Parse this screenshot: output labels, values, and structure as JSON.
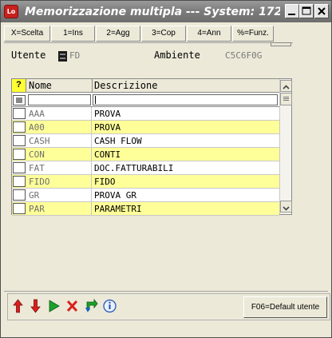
{
  "window": {
    "title": "Memorizzazione multipla --- System: 172...."
  },
  "titlebar_buttons": [
    "minimize-icon",
    "maximize-icon",
    "close-icon"
  ],
  "function_keys": [
    {
      "label": "X=Scelta"
    },
    {
      "label": "1=Ins"
    },
    {
      "label": "2=Agg"
    },
    {
      "label": "3=Cop"
    },
    {
      "label": "4=Ann"
    },
    {
      "label": "%=Funz."
    }
  ],
  "info": {
    "utente_label": "Utente",
    "utente_value": "FD",
    "ambiente_label": "Ambiente",
    "ambiente_value": "C5C6F0G"
  },
  "grid": {
    "header_marker": "?",
    "columns": [
      "Nome",
      "Descrizione"
    ],
    "rows": [
      {
        "code": "AAA",
        "description": "PROVA"
      },
      {
        "code": "A00",
        "description": "PROVA"
      },
      {
        "code": "CASH",
        "description": "CASH FLOW"
      },
      {
        "code": "CON",
        "description": "CONTI"
      },
      {
        "code": "FAT",
        "description": "DOC.FATTURABILI"
      },
      {
        "code": "FIDO",
        "description": "FIDO"
      },
      {
        "code": "GR",
        "description": "PROVA GR"
      },
      {
        "code": "PAR",
        "description": "PARAMETRI"
      }
    ]
  },
  "toolbar": {
    "icons": [
      "arrow-up-icon",
      "arrow-down-icon",
      "play-icon",
      "delete-icon",
      "refresh-icon",
      "info-icon"
    ],
    "default_button": "F06=Default utente"
  },
  "colors": {
    "row_highlight": "#ffff99",
    "header_marker_bg": "#ffff33",
    "titlebar": "#7d7d7d",
    "close_button": "#cc2222"
  }
}
